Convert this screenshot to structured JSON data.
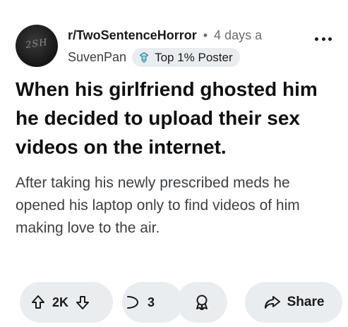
{
  "post": {
    "subreddit": "r/TwoSentenceHorror",
    "separator": "•",
    "time": "4 days a",
    "author": "SuvenPan",
    "author_badge": "Top 1% Poster",
    "avatar_text": "2SH",
    "title": "When his girlfriend ghosted him he decided to upload their sex videos on the internet.",
    "body": "After taking his newly prescribed meds he opened his laptop only to find videos of him making love to the air."
  },
  "actions": {
    "upvote_count": "2K",
    "comment_count": "3",
    "share_label": "Share"
  },
  "icons": {
    "more": "more-horizontal-icon",
    "badge": "top-poster-icon",
    "upvote": "arrow-up-icon",
    "downvote": "arrow-down-icon",
    "comment": "comment-icon",
    "award": "award-icon",
    "share": "share-icon"
  }
}
